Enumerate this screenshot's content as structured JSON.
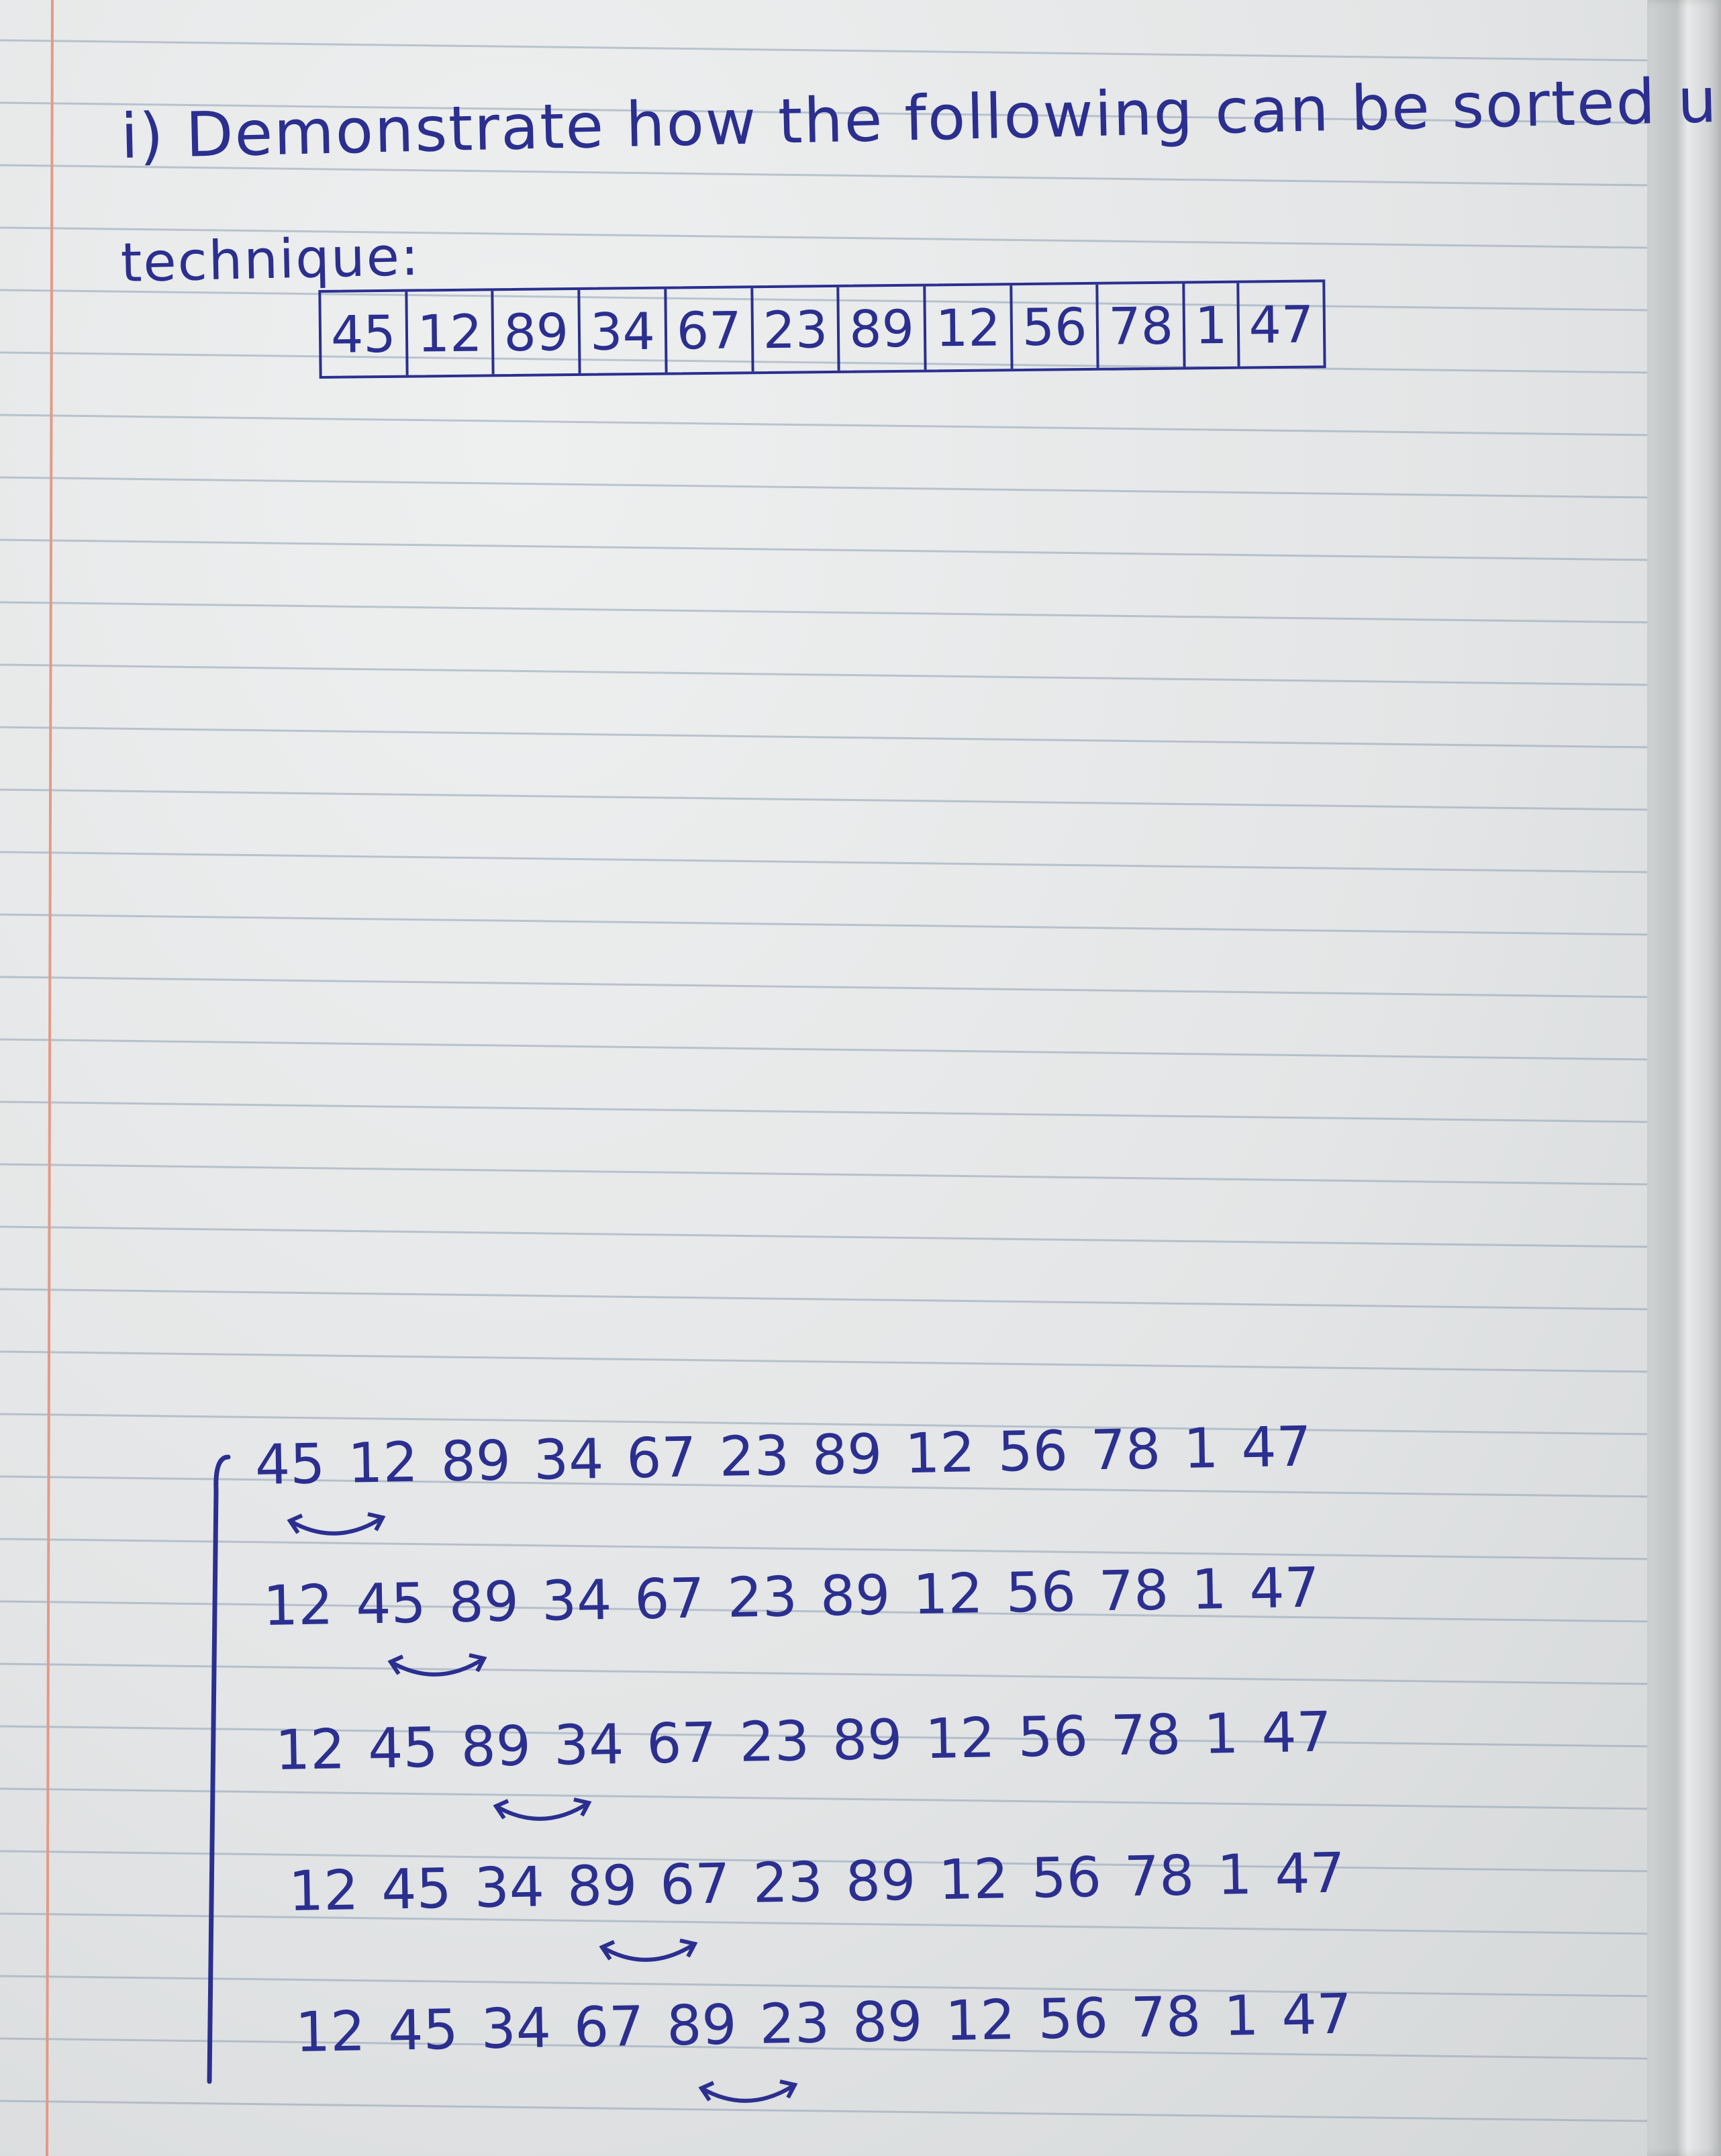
{
  "question": {
    "line1": "i) Demonstrate how the following can be sorted using bubble sort",
    "line2": "technique:"
  },
  "array": [
    "45",
    "12",
    "89",
    "34",
    "67",
    "23",
    "89",
    "12",
    "56",
    "78",
    "1",
    "47"
  ],
  "steps": [
    [
      "45",
      "12",
      "89",
      "34",
      "67",
      "23",
      "89",
      "12",
      "56",
      "78",
      "1",
      "47"
    ],
    [
      "12",
      "45",
      "89",
      "34",
      "67",
      "23",
      "89",
      "12",
      "56",
      "78",
      "1",
      "47"
    ],
    [
      "12",
      "45",
      "89",
      "34",
      "67",
      "23",
      "89",
      "12",
      "56",
      "78",
      "1",
      "47"
    ],
    [
      "12",
      "45",
      "34",
      "89",
      "67",
      "23",
      "89",
      "12",
      "56",
      "78",
      "1",
      "47"
    ],
    [
      "12",
      "45",
      "34",
      "67",
      "89",
      "23",
      "89",
      "12",
      "56",
      "78",
      "1",
      "47"
    ]
  ],
  "colors": {
    "ink": "#2b2f8f",
    "rule": "#8fa2b6",
    "margin": "#e39a86",
    "paper": "#e3e5e6"
  }
}
